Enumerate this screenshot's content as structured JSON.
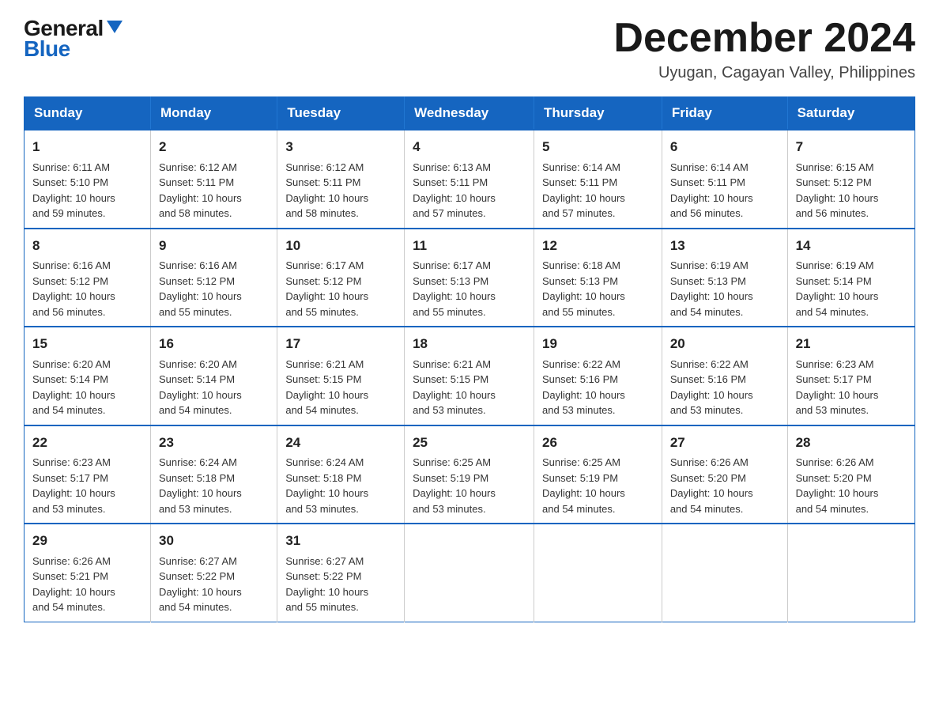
{
  "header": {
    "logo_general": "General",
    "logo_blue": "Blue",
    "month_title": "December 2024",
    "location": "Uyugan, Cagayan Valley, Philippines"
  },
  "weekdays": [
    "Sunday",
    "Monday",
    "Tuesday",
    "Wednesday",
    "Thursday",
    "Friday",
    "Saturday"
  ],
  "weeks": [
    [
      {
        "day": "1",
        "sunrise": "6:11 AM",
        "sunset": "5:10 PM",
        "daylight": "10 hours and 59 minutes."
      },
      {
        "day": "2",
        "sunrise": "6:12 AM",
        "sunset": "5:11 PM",
        "daylight": "10 hours and 58 minutes."
      },
      {
        "day": "3",
        "sunrise": "6:12 AM",
        "sunset": "5:11 PM",
        "daylight": "10 hours and 58 minutes."
      },
      {
        "day": "4",
        "sunrise": "6:13 AM",
        "sunset": "5:11 PM",
        "daylight": "10 hours and 57 minutes."
      },
      {
        "day": "5",
        "sunrise": "6:14 AM",
        "sunset": "5:11 PM",
        "daylight": "10 hours and 57 minutes."
      },
      {
        "day": "6",
        "sunrise": "6:14 AM",
        "sunset": "5:11 PM",
        "daylight": "10 hours and 56 minutes."
      },
      {
        "day": "7",
        "sunrise": "6:15 AM",
        "sunset": "5:12 PM",
        "daylight": "10 hours and 56 minutes."
      }
    ],
    [
      {
        "day": "8",
        "sunrise": "6:16 AM",
        "sunset": "5:12 PM",
        "daylight": "10 hours and 56 minutes."
      },
      {
        "day": "9",
        "sunrise": "6:16 AM",
        "sunset": "5:12 PM",
        "daylight": "10 hours and 55 minutes."
      },
      {
        "day": "10",
        "sunrise": "6:17 AM",
        "sunset": "5:12 PM",
        "daylight": "10 hours and 55 minutes."
      },
      {
        "day": "11",
        "sunrise": "6:17 AM",
        "sunset": "5:13 PM",
        "daylight": "10 hours and 55 minutes."
      },
      {
        "day": "12",
        "sunrise": "6:18 AM",
        "sunset": "5:13 PM",
        "daylight": "10 hours and 55 minutes."
      },
      {
        "day": "13",
        "sunrise": "6:19 AM",
        "sunset": "5:13 PM",
        "daylight": "10 hours and 54 minutes."
      },
      {
        "day": "14",
        "sunrise": "6:19 AM",
        "sunset": "5:14 PM",
        "daylight": "10 hours and 54 minutes."
      }
    ],
    [
      {
        "day": "15",
        "sunrise": "6:20 AM",
        "sunset": "5:14 PM",
        "daylight": "10 hours and 54 minutes."
      },
      {
        "day": "16",
        "sunrise": "6:20 AM",
        "sunset": "5:14 PM",
        "daylight": "10 hours and 54 minutes."
      },
      {
        "day": "17",
        "sunrise": "6:21 AM",
        "sunset": "5:15 PM",
        "daylight": "10 hours and 54 minutes."
      },
      {
        "day": "18",
        "sunrise": "6:21 AM",
        "sunset": "5:15 PM",
        "daylight": "10 hours and 53 minutes."
      },
      {
        "day": "19",
        "sunrise": "6:22 AM",
        "sunset": "5:16 PM",
        "daylight": "10 hours and 53 minutes."
      },
      {
        "day": "20",
        "sunrise": "6:22 AM",
        "sunset": "5:16 PM",
        "daylight": "10 hours and 53 minutes."
      },
      {
        "day": "21",
        "sunrise": "6:23 AM",
        "sunset": "5:17 PM",
        "daylight": "10 hours and 53 minutes."
      }
    ],
    [
      {
        "day": "22",
        "sunrise": "6:23 AM",
        "sunset": "5:17 PM",
        "daylight": "10 hours and 53 minutes."
      },
      {
        "day": "23",
        "sunrise": "6:24 AM",
        "sunset": "5:18 PM",
        "daylight": "10 hours and 53 minutes."
      },
      {
        "day": "24",
        "sunrise": "6:24 AM",
        "sunset": "5:18 PM",
        "daylight": "10 hours and 53 minutes."
      },
      {
        "day": "25",
        "sunrise": "6:25 AM",
        "sunset": "5:19 PM",
        "daylight": "10 hours and 53 minutes."
      },
      {
        "day": "26",
        "sunrise": "6:25 AM",
        "sunset": "5:19 PM",
        "daylight": "10 hours and 54 minutes."
      },
      {
        "day": "27",
        "sunrise": "6:26 AM",
        "sunset": "5:20 PM",
        "daylight": "10 hours and 54 minutes."
      },
      {
        "day": "28",
        "sunrise": "6:26 AM",
        "sunset": "5:20 PM",
        "daylight": "10 hours and 54 minutes."
      }
    ],
    [
      {
        "day": "29",
        "sunrise": "6:26 AM",
        "sunset": "5:21 PM",
        "daylight": "10 hours and 54 minutes."
      },
      {
        "day": "30",
        "sunrise": "6:27 AM",
        "sunset": "5:22 PM",
        "daylight": "10 hours and 54 minutes."
      },
      {
        "day": "31",
        "sunrise": "6:27 AM",
        "sunset": "5:22 PM",
        "daylight": "10 hours and 55 minutes."
      },
      null,
      null,
      null,
      null
    ]
  ],
  "labels": {
    "sunrise": "Sunrise:",
    "sunset": "Sunset:",
    "daylight": "Daylight:"
  }
}
